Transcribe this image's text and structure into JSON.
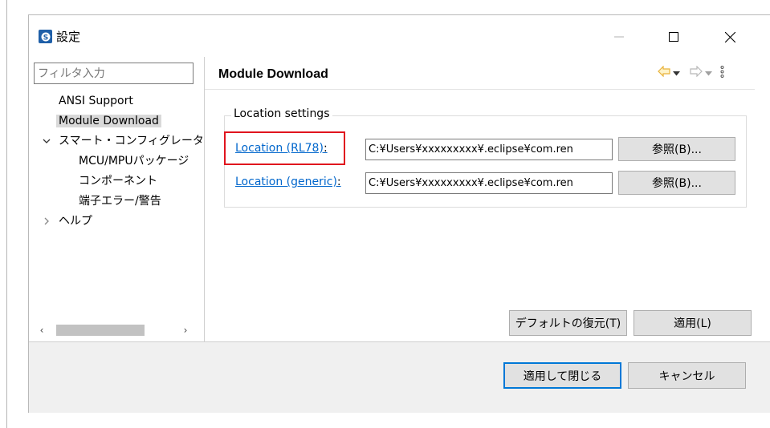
{
  "window": {
    "title": "設定",
    "icon": "settings-app-icon",
    "controls": [
      "minimize-icon",
      "maximize-icon",
      "close-icon"
    ]
  },
  "sidebar": {
    "filter_placeholder": "フィルタ入力",
    "items": [
      {
        "label": "ANSI Support",
        "level": 0,
        "expander": "none",
        "selected": false
      },
      {
        "label": "Module Download",
        "level": 0,
        "expander": "none",
        "selected": true
      },
      {
        "label": "スマート・コンフィグレータ",
        "level": 0,
        "expander": "expanded",
        "selected": false
      },
      {
        "label": "MCU/MPUパッケージ",
        "level": 1,
        "expander": "none",
        "selected": false
      },
      {
        "label": "コンポーネント",
        "level": 1,
        "expander": "none",
        "selected": false
      },
      {
        "label": "端子エラー/警告",
        "level": 1,
        "expander": "none",
        "selected": false
      },
      {
        "label": "ヘルプ",
        "level": 0,
        "expander": "collapsed",
        "selected": false
      }
    ],
    "scrollbar": {
      "left_arrow": "‹",
      "right_arrow": "›"
    }
  },
  "main": {
    "title": "Module Download",
    "nav_icons": [
      "back-arrow-icon",
      "back-menu-icon",
      "forward-arrow-icon",
      "forward-menu-icon",
      "view-menu-icon"
    ],
    "group_label": "Location settings",
    "locations": [
      {
        "label": "Location (RL78)",
        "path": "C:¥Users¥xxxxxxxxx¥.eclipse¥com.ren",
        "browse_label": "参照(B)...",
        "highlighted": true
      },
      {
        "label": "Location (generic)",
        "path": "C:¥Users¥xxxxxxxxx¥.eclipse¥com.ren",
        "browse_label": "参照(B)...",
        "highlighted": false
      }
    ],
    "restore_defaults_label": "デフォルトの復元(T)",
    "apply_label": "適用(L)"
  },
  "footer": {
    "apply_close_label": "適用して閉じる",
    "cancel_label": "キャンセル"
  },
  "colors": {
    "link": "#0066cc",
    "highlight_box": "#e0141e",
    "default_button_border": "#0078d7",
    "nav_arrow": "#e8b23a"
  }
}
